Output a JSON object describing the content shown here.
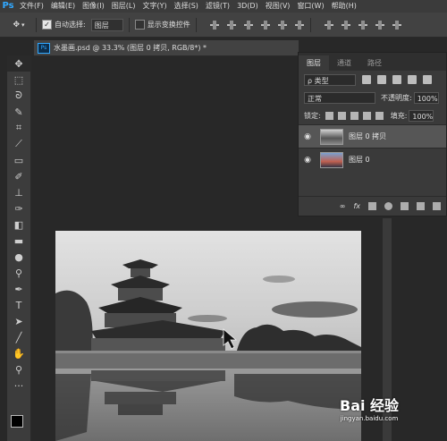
{
  "app_logo": "Ps",
  "menu": [
    "文件(F)",
    "编辑(E)",
    "图像(I)",
    "图层(L)",
    "文字(Y)",
    "选择(S)",
    "滤镜(T)",
    "3D(D)",
    "视图(V)",
    "窗口(W)",
    "帮助(H)"
  ],
  "options": {
    "auto_select_label": "自动选择:",
    "auto_select_value": "图层",
    "show_transform_label": "显示变换控件"
  },
  "document": {
    "title": "水墨画.psd @ 33.3% (图层 0 拷贝, RGB/8*) *"
  },
  "layers_panel": {
    "tabs": [
      "图层",
      "通道",
      "路径"
    ],
    "filter_type": "ρ 类型",
    "blend_mode": "正常",
    "opacity_label": "不透明度:",
    "opacity_value": "100%",
    "lock_label": "锁定:",
    "fill_label": "填充:",
    "fill_value": "100%",
    "footer_fx": "fx",
    "layers": [
      {
        "name": "图层 0 拷贝",
        "visible": true,
        "selected": true
      },
      {
        "name": "图层 0",
        "visible": true,
        "selected": false
      }
    ]
  },
  "watermark": {
    "logo": "Bai 经验",
    "url": "jingyan.baidu.com"
  }
}
